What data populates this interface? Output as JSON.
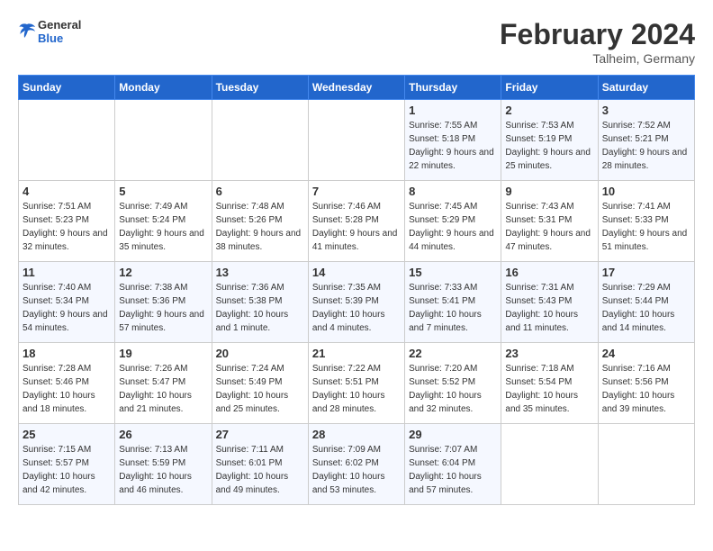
{
  "header": {
    "logo_general": "General",
    "logo_blue": "Blue",
    "month_title": "February 2024",
    "location": "Talheim, Germany"
  },
  "weekdays": [
    "Sunday",
    "Monday",
    "Tuesday",
    "Wednesday",
    "Thursday",
    "Friday",
    "Saturday"
  ],
  "weeks": [
    [
      {
        "day": "",
        "sunrise": "",
        "sunset": "",
        "daylight": ""
      },
      {
        "day": "",
        "sunrise": "",
        "sunset": "",
        "daylight": ""
      },
      {
        "day": "",
        "sunrise": "",
        "sunset": "",
        "daylight": ""
      },
      {
        "day": "",
        "sunrise": "",
        "sunset": "",
        "daylight": ""
      },
      {
        "day": "1",
        "sunrise": "Sunrise: 7:55 AM",
        "sunset": "Sunset: 5:18 PM",
        "daylight": "Daylight: 9 hours and 22 minutes."
      },
      {
        "day": "2",
        "sunrise": "Sunrise: 7:53 AM",
        "sunset": "Sunset: 5:19 PM",
        "daylight": "Daylight: 9 hours and 25 minutes."
      },
      {
        "day": "3",
        "sunrise": "Sunrise: 7:52 AM",
        "sunset": "Sunset: 5:21 PM",
        "daylight": "Daylight: 9 hours and 28 minutes."
      }
    ],
    [
      {
        "day": "4",
        "sunrise": "Sunrise: 7:51 AM",
        "sunset": "Sunset: 5:23 PM",
        "daylight": "Daylight: 9 hours and 32 minutes."
      },
      {
        "day": "5",
        "sunrise": "Sunrise: 7:49 AM",
        "sunset": "Sunset: 5:24 PM",
        "daylight": "Daylight: 9 hours and 35 minutes."
      },
      {
        "day": "6",
        "sunrise": "Sunrise: 7:48 AM",
        "sunset": "Sunset: 5:26 PM",
        "daylight": "Daylight: 9 hours and 38 minutes."
      },
      {
        "day": "7",
        "sunrise": "Sunrise: 7:46 AM",
        "sunset": "Sunset: 5:28 PM",
        "daylight": "Daylight: 9 hours and 41 minutes."
      },
      {
        "day": "8",
        "sunrise": "Sunrise: 7:45 AM",
        "sunset": "Sunset: 5:29 PM",
        "daylight": "Daylight: 9 hours and 44 minutes."
      },
      {
        "day": "9",
        "sunrise": "Sunrise: 7:43 AM",
        "sunset": "Sunset: 5:31 PM",
        "daylight": "Daylight: 9 hours and 47 minutes."
      },
      {
        "day": "10",
        "sunrise": "Sunrise: 7:41 AM",
        "sunset": "Sunset: 5:33 PM",
        "daylight": "Daylight: 9 hours and 51 minutes."
      }
    ],
    [
      {
        "day": "11",
        "sunrise": "Sunrise: 7:40 AM",
        "sunset": "Sunset: 5:34 PM",
        "daylight": "Daylight: 9 hours and 54 minutes."
      },
      {
        "day": "12",
        "sunrise": "Sunrise: 7:38 AM",
        "sunset": "Sunset: 5:36 PM",
        "daylight": "Daylight: 9 hours and 57 minutes."
      },
      {
        "day": "13",
        "sunrise": "Sunrise: 7:36 AM",
        "sunset": "Sunset: 5:38 PM",
        "daylight": "Daylight: 10 hours and 1 minute."
      },
      {
        "day": "14",
        "sunrise": "Sunrise: 7:35 AM",
        "sunset": "Sunset: 5:39 PM",
        "daylight": "Daylight: 10 hours and 4 minutes."
      },
      {
        "day": "15",
        "sunrise": "Sunrise: 7:33 AM",
        "sunset": "Sunset: 5:41 PM",
        "daylight": "Daylight: 10 hours and 7 minutes."
      },
      {
        "day": "16",
        "sunrise": "Sunrise: 7:31 AM",
        "sunset": "Sunset: 5:43 PM",
        "daylight": "Daylight: 10 hours and 11 minutes."
      },
      {
        "day": "17",
        "sunrise": "Sunrise: 7:29 AM",
        "sunset": "Sunset: 5:44 PM",
        "daylight": "Daylight: 10 hours and 14 minutes."
      }
    ],
    [
      {
        "day": "18",
        "sunrise": "Sunrise: 7:28 AM",
        "sunset": "Sunset: 5:46 PM",
        "daylight": "Daylight: 10 hours and 18 minutes."
      },
      {
        "day": "19",
        "sunrise": "Sunrise: 7:26 AM",
        "sunset": "Sunset: 5:47 PM",
        "daylight": "Daylight: 10 hours and 21 minutes."
      },
      {
        "day": "20",
        "sunrise": "Sunrise: 7:24 AM",
        "sunset": "Sunset: 5:49 PM",
        "daylight": "Daylight: 10 hours and 25 minutes."
      },
      {
        "day": "21",
        "sunrise": "Sunrise: 7:22 AM",
        "sunset": "Sunset: 5:51 PM",
        "daylight": "Daylight: 10 hours and 28 minutes."
      },
      {
        "day": "22",
        "sunrise": "Sunrise: 7:20 AM",
        "sunset": "Sunset: 5:52 PM",
        "daylight": "Daylight: 10 hours and 32 minutes."
      },
      {
        "day": "23",
        "sunrise": "Sunrise: 7:18 AM",
        "sunset": "Sunset: 5:54 PM",
        "daylight": "Daylight: 10 hours and 35 minutes."
      },
      {
        "day": "24",
        "sunrise": "Sunrise: 7:16 AM",
        "sunset": "Sunset: 5:56 PM",
        "daylight": "Daylight: 10 hours and 39 minutes."
      }
    ],
    [
      {
        "day": "25",
        "sunrise": "Sunrise: 7:15 AM",
        "sunset": "Sunset: 5:57 PM",
        "daylight": "Daylight: 10 hours and 42 minutes."
      },
      {
        "day": "26",
        "sunrise": "Sunrise: 7:13 AM",
        "sunset": "Sunset: 5:59 PM",
        "daylight": "Daylight: 10 hours and 46 minutes."
      },
      {
        "day": "27",
        "sunrise": "Sunrise: 7:11 AM",
        "sunset": "Sunset: 6:01 PM",
        "daylight": "Daylight: 10 hours and 49 minutes."
      },
      {
        "day": "28",
        "sunrise": "Sunrise: 7:09 AM",
        "sunset": "Sunset: 6:02 PM",
        "daylight": "Daylight: 10 hours and 53 minutes."
      },
      {
        "day": "29",
        "sunrise": "Sunrise: 7:07 AM",
        "sunset": "Sunset: 6:04 PM",
        "daylight": "Daylight: 10 hours and 57 minutes."
      },
      {
        "day": "",
        "sunrise": "",
        "sunset": "",
        "daylight": ""
      },
      {
        "day": "",
        "sunrise": "",
        "sunset": "",
        "daylight": ""
      }
    ]
  ]
}
